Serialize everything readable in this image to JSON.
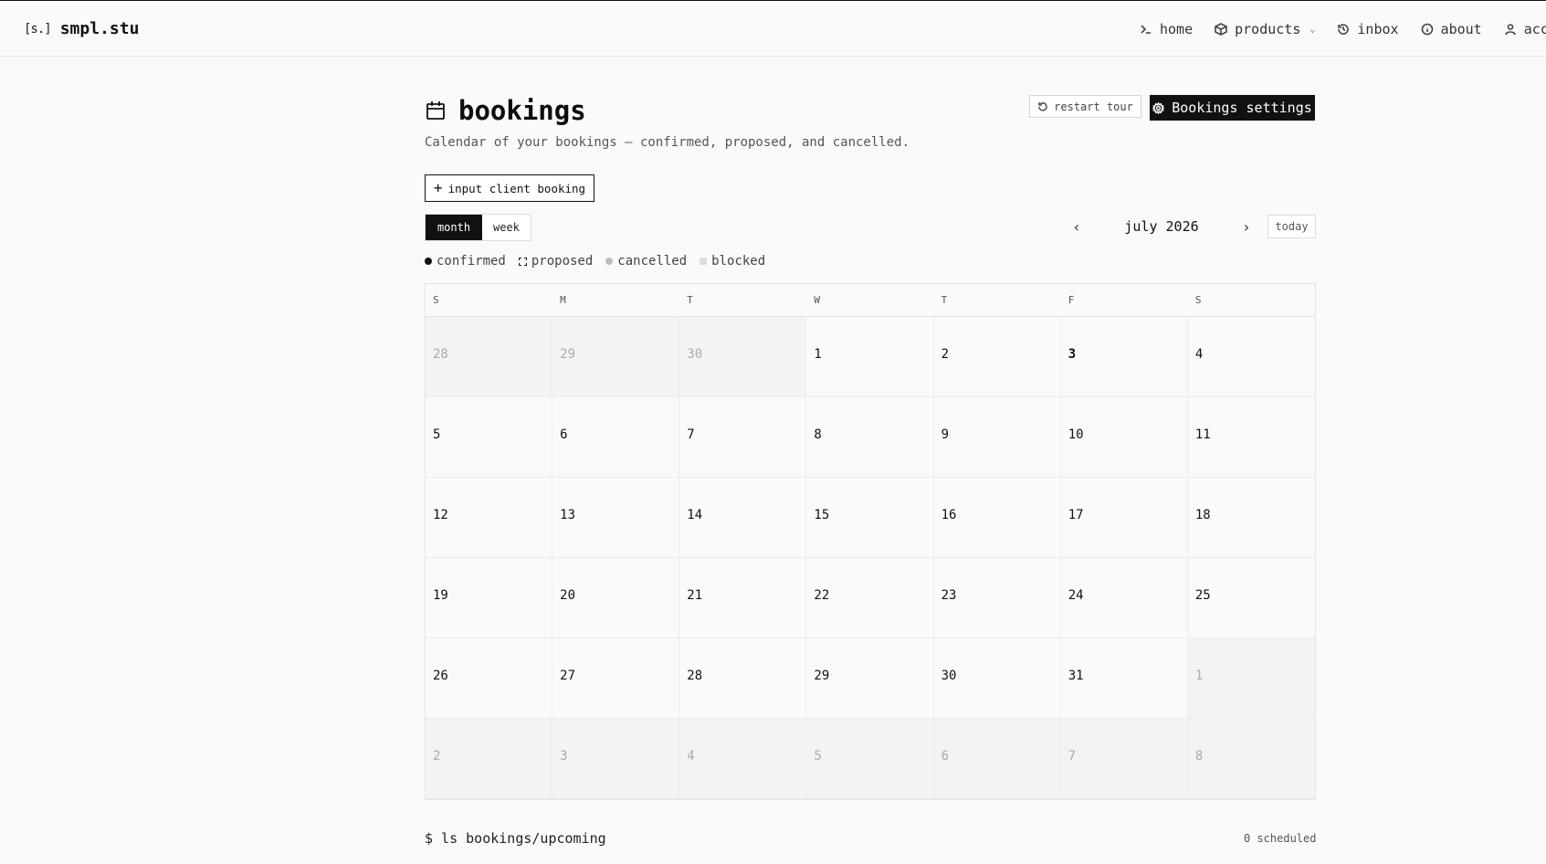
{
  "brand": {
    "mark": "[s.]",
    "name": "smpl.stu"
  },
  "nav": [
    {
      "label": "home",
      "icon": "terminal-icon"
    },
    {
      "label": "products",
      "icon": "box-icon",
      "dropdown": true
    },
    {
      "label": "inbox",
      "icon": "history-icon"
    },
    {
      "label": "about",
      "icon": "info-icon"
    },
    {
      "label": "acco",
      "icon": "user-icon"
    }
  ],
  "header": {
    "title": "bookings",
    "subtitle": "Calendar of your bookings — confirmed, proposed, and cancelled.",
    "restart_label": "restart tour",
    "settings_label": "Bookings settings"
  },
  "actions": {
    "input_booking_label": "input client booking"
  },
  "view": {
    "month_label": "month",
    "week_label": "week",
    "selected": "month"
  },
  "month_nav": {
    "prev": "‹",
    "label": "july 2026",
    "next": "›",
    "today_label": "today"
  },
  "legend": {
    "confirmed": "confirmed",
    "proposed": "proposed",
    "cancelled": "cancelled",
    "blocked": "blocked"
  },
  "calendar": {
    "weekdays": [
      "S",
      "M",
      "T",
      "W",
      "T",
      "F",
      "S"
    ],
    "days": [
      {
        "n": "28",
        "other": true
      },
      {
        "n": "29",
        "other": true
      },
      {
        "n": "30",
        "other": true
      },
      {
        "n": "1"
      },
      {
        "n": "2"
      },
      {
        "n": "3",
        "today": true
      },
      {
        "n": "4"
      },
      {
        "n": "5"
      },
      {
        "n": "6"
      },
      {
        "n": "7"
      },
      {
        "n": "8"
      },
      {
        "n": "9"
      },
      {
        "n": "10"
      },
      {
        "n": "11"
      },
      {
        "n": "12"
      },
      {
        "n": "13"
      },
      {
        "n": "14"
      },
      {
        "n": "15"
      },
      {
        "n": "16"
      },
      {
        "n": "17"
      },
      {
        "n": "18"
      },
      {
        "n": "19"
      },
      {
        "n": "20"
      },
      {
        "n": "21"
      },
      {
        "n": "22"
      },
      {
        "n": "23"
      },
      {
        "n": "24"
      },
      {
        "n": "25"
      },
      {
        "n": "26"
      },
      {
        "n": "27"
      },
      {
        "n": "28"
      },
      {
        "n": "29"
      },
      {
        "n": "30"
      },
      {
        "n": "31"
      },
      {
        "n": "1",
        "other": true
      },
      {
        "n": "2",
        "other": true
      },
      {
        "n": "3",
        "other": true
      },
      {
        "n": "4",
        "other": true
      },
      {
        "n": "5",
        "other": true
      },
      {
        "n": "6",
        "other": true
      },
      {
        "n": "7",
        "other": true
      },
      {
        "n": "8",
        "other": true
      }
    ]
  },
  "upcoming": {
    "title": "$ ls bookings/upcoming",
    "count": "0 scheduled"
  }
}
